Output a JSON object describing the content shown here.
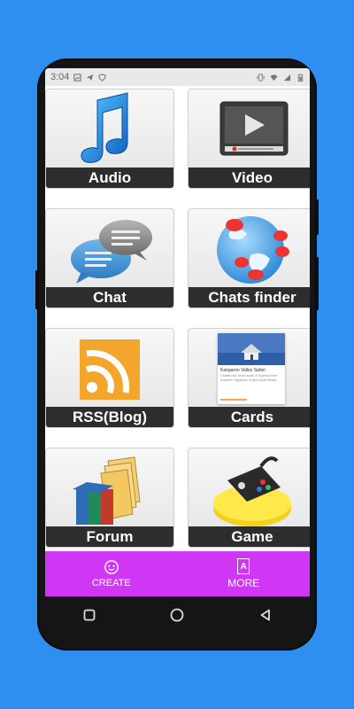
{
  "status_bar": {
    "time": "3:04"
  },
  "tiles": [
    {
      "label": "Audio",
      "icon": "music-note-icon"
    },
    {
      "label": "Video",
      "icon": "video-player-icon"
    },
    {
      "label": "Chat",
      "icon": "chat-bubbles-icon"
    },
    {
      "label": "Chats finder",
      "icon": "globe-chat-icon"
    },
    {
      "label": "RSS(Blog)",
      "icon": "rss-feed-icon"
    },
    {
      "label": "Cards",
      "icon": "card-preview-icon",
      "card_preview": {
        "title": "Kangaroo Valley Safari",
        "text": "Located two hours south of Sydney in the Southern Highlands of New South Wales..."
      }
    },
    {
      "label": "Forum",
      "icon": "books-folders-icon"
    },
    {
      "label": "Game",
      "icon": "gamepad-icon"
    }
  ],
  "bottom_nav": [
    {
      "label": "CREATE",
      "icon": "create-face-icon"
    },
    {
      "label": "MORE",
      "icon": "more-badge-icon",
      "icon_letter": "A"
    }
  ],
  "colors": {
    "background": "#2e8ff0",
    "nav": "#d037f4",
    "tile_label_bg": "#2d2d2d"
  }
}
